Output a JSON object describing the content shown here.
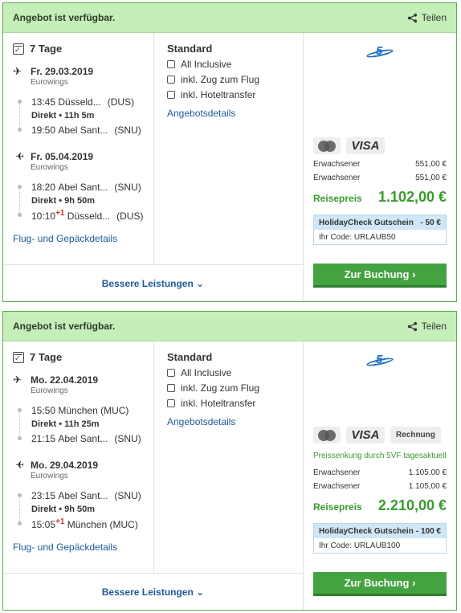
{
  "offers": [
    {
      "availability": "Angebot ist verfügbar.",
      "share": "Teilen",
      "duration": "7 Tage",
      "outbound": {
        "date": "Fr. 29.03.2019",
        "carrier": "Eurowings",
        "dep_time": "13:45",
        "dep_city": "Düsseld...",
        "dep_code": "(DUS)",
        "direct": "Direkt",
        "flight_time": "11h 5m",
        "arr_time": "19:50",
        "arr_plus": "",
        "arr_city": "Abel Sant...",
        "arr_code": "(SNU)"
      },
      "return": {
        "date": "Fr. 05.04.2019",
        "carrier": "Eurowings",
        "dep_time": "18:20",
        "dep_city": "Abel Sant...",
        "dep_code": "(SNU)",
        "direct": "Direkt",
        "flight_time": "9h 50m",
        "arr_time": "10:10",
        "arr_plus": "+1",
        "arr_city": "Düsseld...",
        "arr_code": "(DUS)"
      },
      "flight_details_link": "Flug- und Gepäckdetails",
      "board": "Standard",
      "features": [
        "All Inclusive",
        "inkl. Zug zum Flug",
        "inkl. Hoteltransfer"
      ],
      "offer_details_link": "Angebotsdetails",
      "more_services": "Bessere Leistungen",
      "payment": [
        "MasterCard",
        "VISA"
      ],
      "promo": "",
      "price_rows": [
        {
          "label": "Erwachsener",
          "value": "551,00 €"
        },
        {
          "label": "Erwachsener",
          "value": "551,00 €"
        }
      ],
      "total_label": "Reisepreis",
      "total": "1.102,00 €",
      "voucher_title": "HolidayCheck Gutschein",
      "voucher_amount": "- 50 €",
      "voucher_code": "Ihr Code: URLAUB50",
      "book": "Zur Buchung"
    },
    {
      "availability": "Angebot ist verfügbar.",
      "share": "Teilen",
      "duration": "7 Tage",
      "outbound": {
        "date": "Mo. 22.04.2019",
        "carrier": "Eurowings",
        "dep_time": "15:50",
        "dep_city": "München",
        "dep_code": "(MUC)",
        "direct": "Direkt",
        "flight_time": "11h 25m",
        "arr_time": "21:15",
        "arr_plus": "",
        "arr_city": "Abel Sant...",
        "arr_code": "(SNU)"
      },
      "return": {
        "date": "Mo. 29.04.2019",
        "carrier": "Eurowings",
        "dep_time": "23:15",
        "dep_city": "Abel Sant...",
        "dep_code": "(SNU)",
        "direct": "Direkt",
        "flight_time": "9h 50m",
        "arr_time": "15:05",
        "arr_plus": "+1",
        "arr_city": "München",
        "arr_code": "(MUC)"
      },
      "flight_details_link": "Flug- und Gepäckdetails",
      "board": "Standard",
      "features": [
        "All Inclusive",
        "inkl. Zug zum Flug",
        "inkl. Hoteltransfer"
      ],
      "offer_details_link": "Angebotsdetails",
      "more_services": "Bessere Leistungen",
      "payment": [
        "MasterCard",
        "VISA",
        "Rechnung"
      ],
      "promo": "Preissenkung durch 5VF tagesaktuell",
      "price_rows": [
        {
          "label": "Erwachsener",
          "value": "1.105,00 €"
        },
        {
          "label": "Erwachsener",
          "value": "1.105,00 €"
        }
      ],
      "total_label": "Reisepreis",
      "total": "2.210,00 €",
      "voucher_title": "HolidayCheck Gutschein",
      "voucher_amount": "- 100 €",
      "voucher_code": "Ihr Code: URLAUB100",
      "book": "Zur Buchung"
    }
  ],
  "colors": {
    "header_bg": "#c6eeb9",
    "border": "#56b04a",
    "link": "#1d5a9a",
    "price_green": "#3a9b2d",
    "button": "#43a341",
    "voucher_bg": "#cfe7f6"
  },
  "icons": [
    "share-icon",
    "calendar-icon",
    "plane-depart-icon",
    "plane-arrive-icon",
    "meal-icon",
    "train-icon",
    "bus-icon",
    "chevron-down-icon",
    "chevron-right-icon",
    "tour-operator-logo"
  ]
}
